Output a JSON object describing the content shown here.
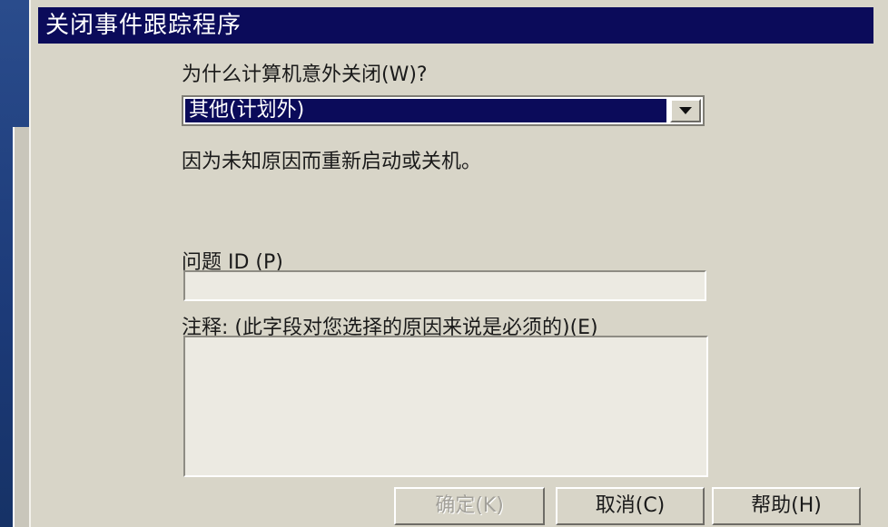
{
  "dialog": {
    "title": "关闭事件跟踪程序",
    "reason_question": "为什么计算机意外关闭(W)?",
    "reason_selected": "其他(计划外)",
    "reason_description": "因为未知原因而重新启动或关机。",
    "problem_id_label": "问题 ID (P)",
    "problem_id_value": "",
    "comment_label": "注释: (此字段对您选择的原因来说是必须的)(E)",
    "comment_value": ""
  },
  "buttons": {
    "ok": "确定(K)",
    "cancel": "取消(C)",
    "help": "帮助(H)"
  }
}
